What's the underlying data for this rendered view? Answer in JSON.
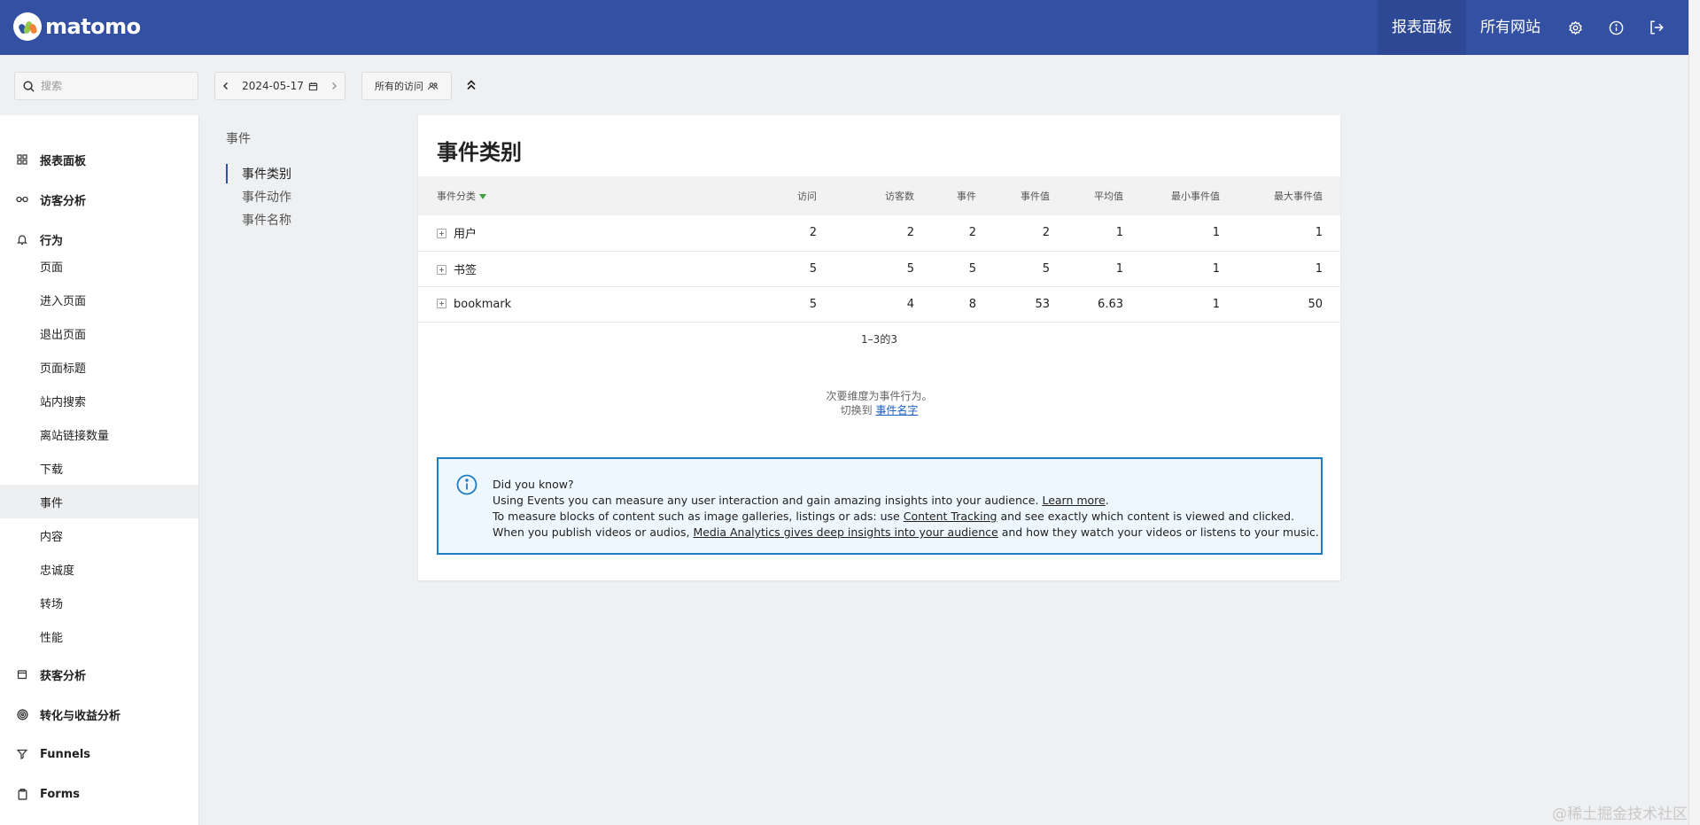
{
  "app": {
    "name": "matomo"
  },
  "topnav": {
    "dashboard": "报表面板",
    "all_sites": "所有网站"
  },
  "controls": {
    "search_placeholder": "搜索",
    "date": "2024-05-17",
    "segment": "所有的访问"
  },
  "sidebar": {
    "sections": {
      "dashboard": "报表面板",
      "visitors": "访客分析",
      "behaviour": "行为",
      "acquisition": "获客分析",
      "goals": "转化与收益分析",
      "funnels": "Funnels",
      "forms": "Forms"
    },
    "behaviour_items": [
      "页面",
      "进入页面",
      "退出页面",
      "页面标题",
      "站内搜索",
      "离站链接数量",
      "下载",
      "事件",
      "内容",
      "忠诚度",
      "转场",
      "性能"
    ],
    "active_item": "事件"
  },
  "subnav": {
    "title": "事件",
    "items": [
      "事件类别",
      "事件动作",
      "事件名称"
    ]
  },
  "report": {
    "title": "事件类别",
    "columns": [
      "事件分类",
      "访问",
      "访客数",
      "事件",
      "事件值",
      "平均值",
      "最小事件值",
      "最大事件值"
    ],
    "rows": [
      {
        "label": "用户",
        "visits": "2",
        "visitors": "2",
        "events": "2",
        "event_value": "2",
        "avg": "1",
        "min": "1",
        "max": "1"
      },
      {
        "label": "书签",
        "visits": "5",
        "visitors": "5",
        "events": "5",
        "event_value": "5",
        "avg": "1",
        "min": "1",
        "max": "1"
      },
      {
        "label": "bookmark",
        "visits": "5",
        "visitors": "4",
        "events": "8",
        "event_value": "53",
        "avg": "6.63",
        "min": "1",
        "max": "50"
      }
    ],
    "pagination": "1–3的3",
    "related_line1": "次要维度为事件行为。",
    "related_prefix": "切换到",
    "related_link": "事件名字"
  },
  "info": {
    "title": "Did you know?",
    "l1_text": "Using Events you can measure any user interaction and gain amazing insights into your audience.",
    "l1_link": "Learn more",
    "l1_end": ".",
    "l2_text": "To measure blocks of content such as image galleries, listings or ads: use",
    "l2_link": "Content Tracking",
    "l2_end": "and see exactly which content is viewed and clicked.",
    "l3_text": "When you publish videos or audios,",
    "l3_link": "Media Analytics gives deep insights into your audience",
    "l3_end": "and how they watch your videos or listens to your music."
  },
  "watermark": "@稀土掘金技术社区"
}
